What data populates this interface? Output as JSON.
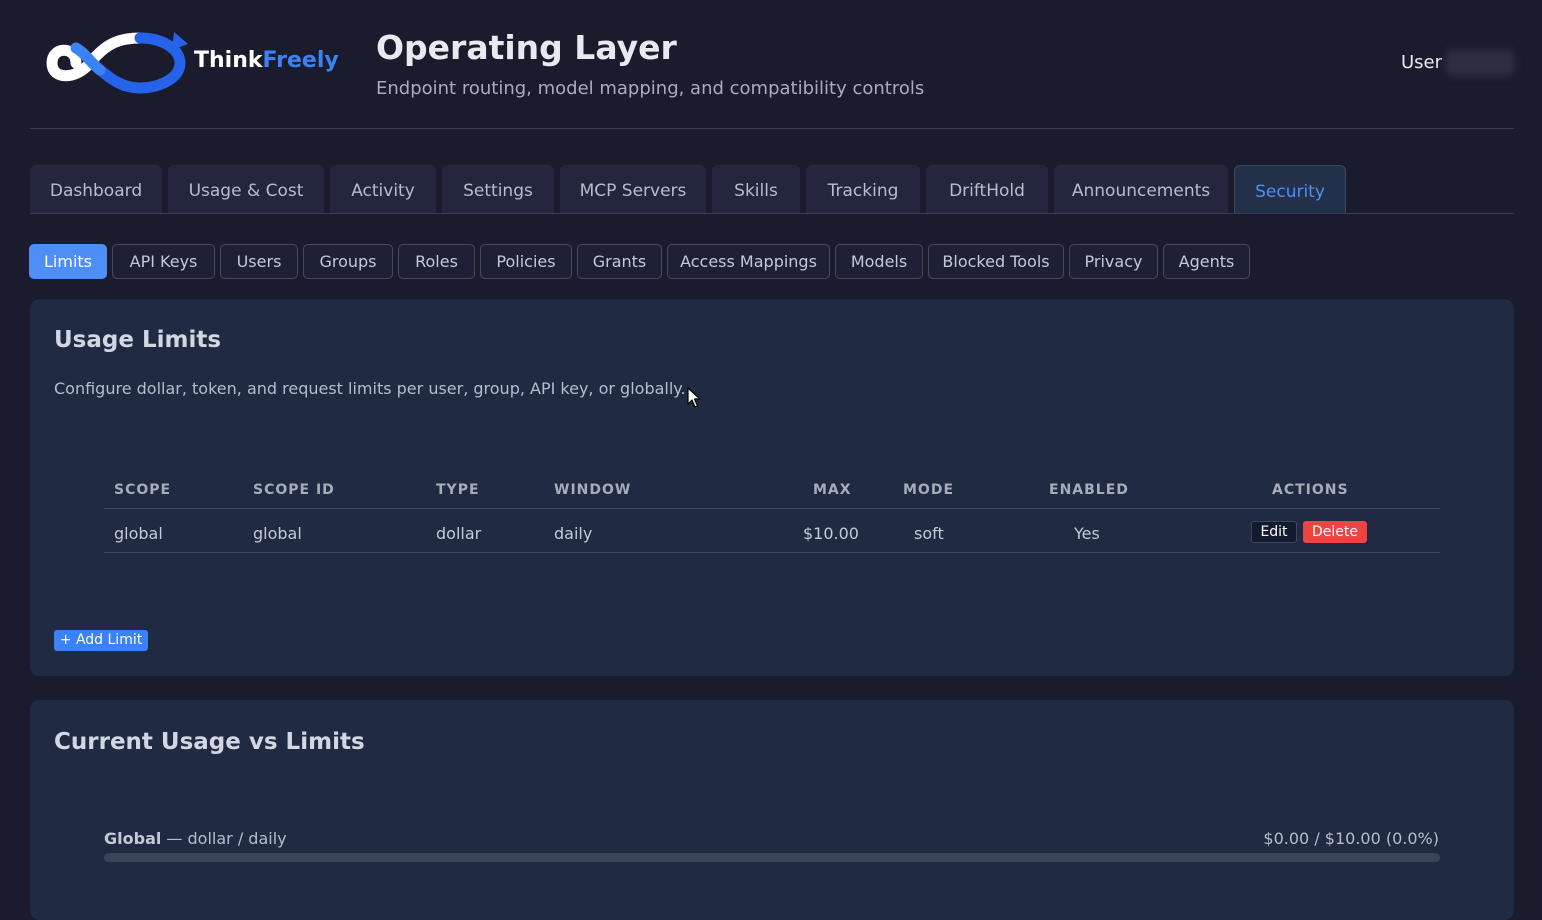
{
  "brand": {
    "name_part1": "Think",
    "name_part2": "Freely",
    "accent": "#3b82f6"
  },
  "header": {
    "title": "Operating Layer",
    "subtitle": "Endpoint routing, model mapping, and compatibility controls",
    "user_label": "User"
  },
  "main_tabs": [
    "Dashboard",
    "Usage & Cost",
    "Activity",
    "Settings",
    "MCP Servers",
    "Skills",
    "Tracking",
    "DriftHold",
    "Announcements",
    "Security"
  ],
  "main_tab_active": "Security",
  "sub_tabs": [
    "Limits",
    "API Keys",
    "Users",
    "Groups",
    "Roles",
    "Policies",
    "Grants",
    "Access Mappings",
    "Models",
    "Blocked Tools",
    "Privacy",
    "Agents"
  ],
  "sub_tab_active": "Limits",
  "limits": {
    "title": "Usage Limits",
    "description": "Configure dollar, token, and request limits per user, group, API key, or globally.",
    "columns": [
      "SCOPE",
      "SCOPE ID",
      "TYPE",
      "WINDOW",
      "MAX",
      "MODE",
      "ENABLED",
      "ACTIONS"
    ],
    "rows": [
      {
        "scope": "global",
        "scope_id": "global",
        "type": "dollar",
        "window": "daily",
        "max": "$10.00",
        "mode": "soft",
        "enabled": "Yes"
      }
    ],
    "edit_label": "Edit",
    "delete_label": "Delete",
    "add_label": "+ Add Limit"
  },
  "usage": {
    "title": "Current Usage vs Limits",
    "items": [
      {
        "scope": "Global",
        "detail": " — dollar / daily",
        "value": "$0.00 / $10.00 (0.0%)",
        "fraction": 0.0
      }
    ]
  }
}
